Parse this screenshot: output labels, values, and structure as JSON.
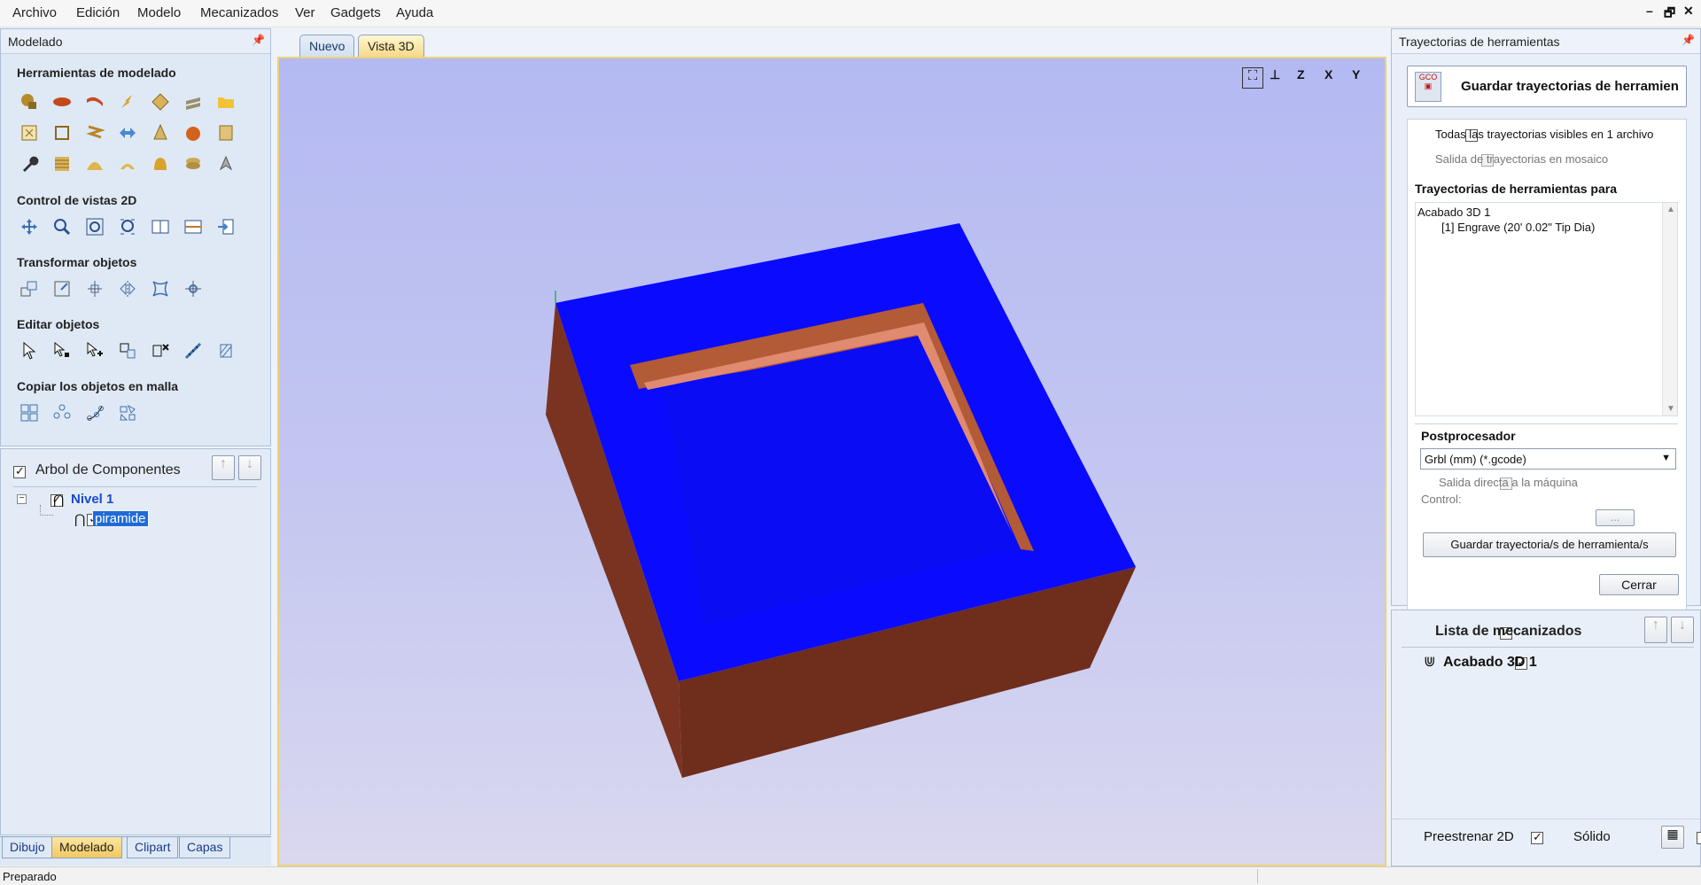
{
  "menu": [
    "Archivo",
    "Edición",
    "Modelo",
    "Mecanizados",
    "Ver",
    "Gadgets",
    "Ayuda"
  ],
  "window_controls": [
    "–",
    "🗗",
    "✕"
  ],
  "left_panel": {
    "title": "Modelado",
    "sections": {
      "modeling_tools": "Herramientas de modelado",
      "view_control_2d": "Control de vistas 2D",
      "transform": "Transformar objetos",
      "edit": "Editar objetos",
      "array_copy": "Copiar los objetos en malla"
    },
    "component_tree": {
      "title": "Arbol de Componentes",
      "level": "Nivel 1",
      "item": "piramide"
    },
    "bottom_tabs": [
      "Dibujo",
      "Modelado",
      "Clipart",
      "Capas"
    ]
  },
  "view_tabs": [
    "Nuevo",
    "Vista 3D"
  ],
  "view_toolbar_icons": [
    "zoom-extents-icon",
    "iso-view-icon",
    "z-view-icon",
    "x-view-icon",
    "y-view-icon"
  ],
  "right_panel": {
    "title": "Trayectorias de herramientas",
    "save_button": "Guardar trayectorias de herramien",
    "all_visible_checkbox": "Todas las trayectorias visibles en 1 archivo",
    "tile_output_checkbox": "Salida de trayectorias en mosaico",
    "toolpaths_for_label": "Trayectorias de herramientas para",
    "toolpath_list": [
      "Acabado 3D 1",
      "[1] Engrave (20' 0.02\" Tip Dia)"
    ],
    "postprocessor_label": "Postprocesador",
    "postprocessor_value": "Grbl (mm) (*.gcode)",
    "direct_output": "Salida directa a la máquina",
    "control_label": "Control:",
    "control_button": "...",
    "save_toolpaths_button": "Guardar trayectoria/s de herramienta/s",
    "close_button": "Cerrar",
    "machining_list_title": "Lista de mecanizados",
    "machining_item": "Acabado 3D 1",
    "preview_2d": "Preestrenar 2D",
    "solid": "Sólido"
  },
  "status_text": "Preparado",
  "colors": {
    "accent": "#f6d98a",
    "model_top": "#0a0aff",
    "model_side": "#7a3320",
    "inner_wall": "#e08a70"
  }
}
